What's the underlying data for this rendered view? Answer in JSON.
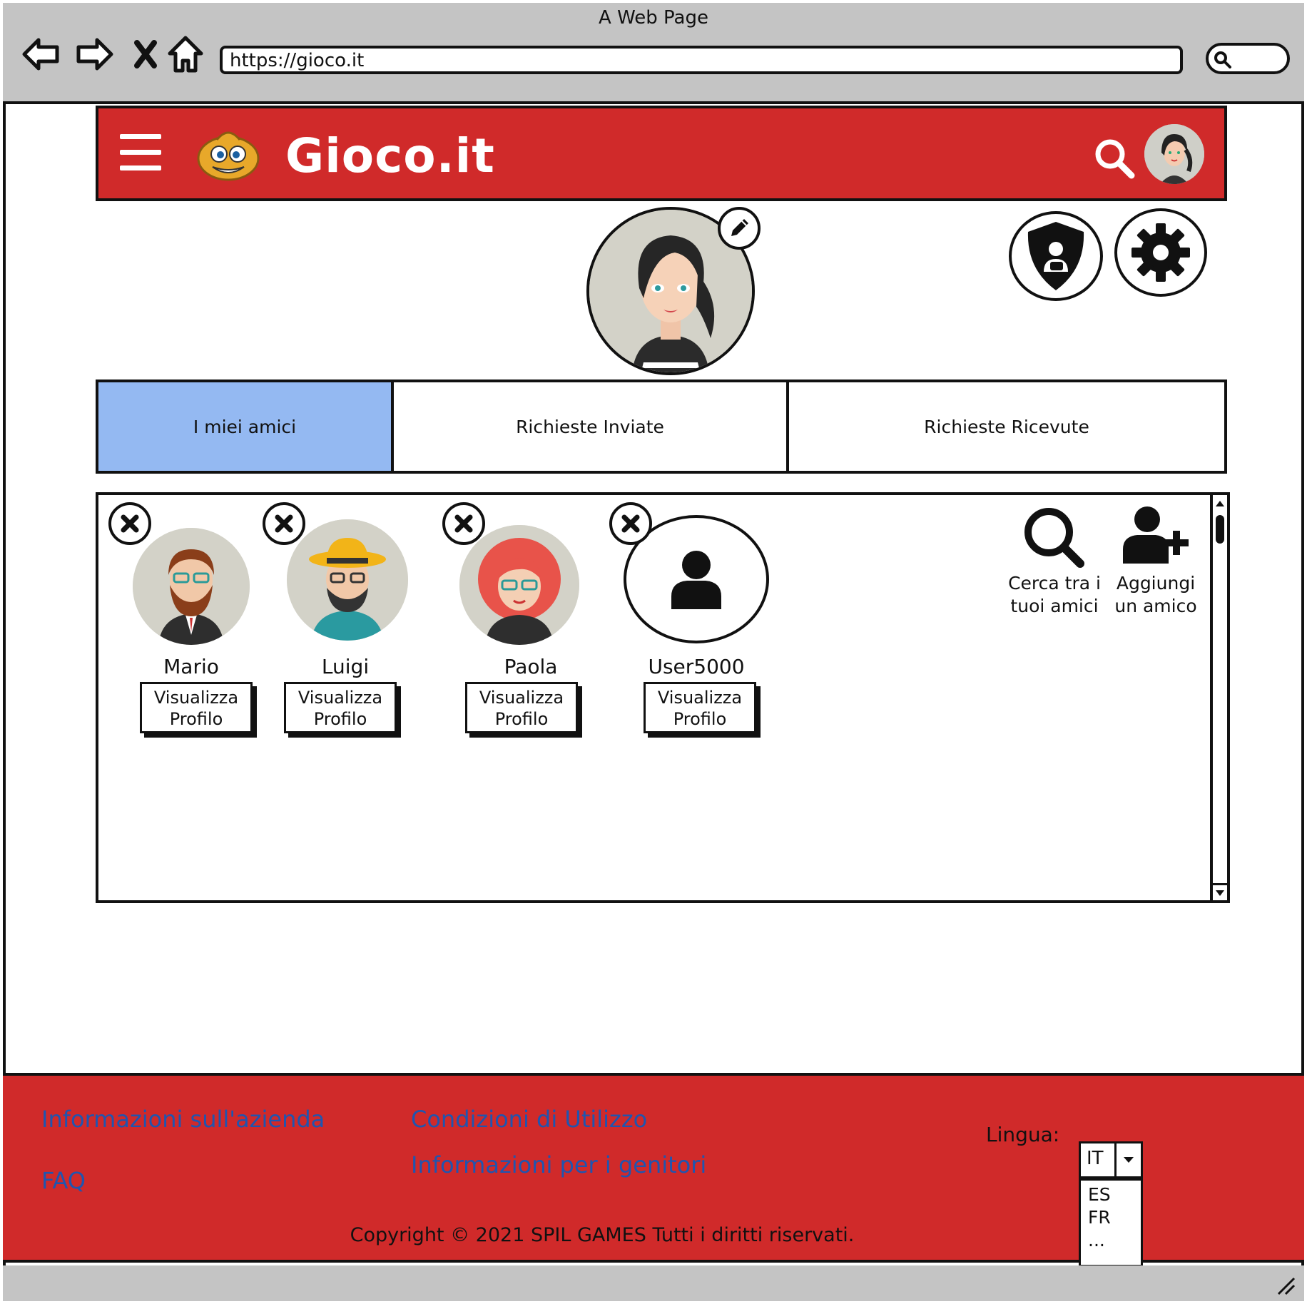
{
  "window": {
    "title": "A Web Page",
    "url": "https://gioco.it"
  },
  "header": {
    "title": "Gioco.it"
  },
  "tabs": [
    {
      "label": "I miei amici",
      "active": true
    },
    {
      "label": "Richieste Inviate",
      "active": false
    },
    {
      "label": "Richieste Ricevute",
      "active": false
    }
  ],
  "friends": [
    {
      "name": "Mario",
      "button": "Visualizza Profilo"
    },
    {
      "name": "Luigi",
      "button": "Visualizza Profilo"
    },
    {
      "name": "Paola",
      "button": "Visualizza Profilo"
    },
    {
      "name": "User5000",
      "button": "Visualizza Profilo"
    }
  ],
  "actions": {
    "search_friends": "Cerca tra i tuoi amici",
    "add_friend": "Aggiungi un amico"
  },
  "footer": {
    "links": {
      "company_info": "Informazioni sull'azienda",
      "faq": "FAQ",
      "terms": "Condizioni di Utilizzo",
      "parents_info": "Informazioni per i genitori"
    },
    "language_label": "Lingua:",
    "language_selected": "IT",
    "language_options": [
      "ES",
      "FR",
      "..."
    ],
    "copyright": "Copyright © 2021 SPIL GAMES Tutti i diritti riservati."
  },
  "colors": {
    "brand_red": "#d02a2a",
    "active_tab": "#94b9f2",
    "link_blue": "#1f55b0",
    "chrome_grey": "#c4c4c4"
  },
  "icons": {
    "back": "back-arrow-icon",
    "forward": "forward-arrow-icon",
    "stop": "close-x-icon",
    "home": "home-icon",
    "menu": "hamburger-icon",
    "search": "search-icon",
    "edit": "pencil-icon",
    "parental": "parental-control-shield-icon",
    "settings": "gear-icon",
    "remove": "remove-x-icon",
    "add_user": "add-user-icon",
    "user": "user-silhouette-icon"
  }
}
